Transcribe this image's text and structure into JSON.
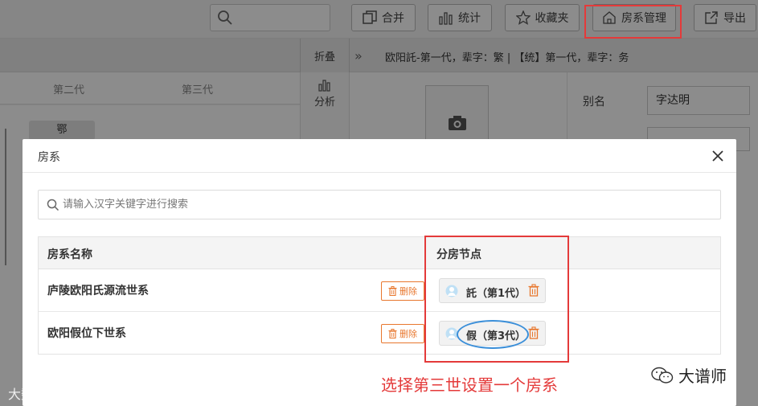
{
  "toolbar": {
    "merge_label": "合并",
    "stats_label": "统计",
    "favorites_label": "收藏夹",
    "branch_mgmt_label": "房系管理",
    "export_label": "导出"
  },
  "subbar": {
    "fold_label": "折叠",
    "info": "欧阳託-第一代，辈字：繁   |   【统】第一代，辈字：务"
  },
  "tree": {
    "gen2": "第二代",
    "gen3": "第三代",
    "node_label": "鄂"
  },
  "side": {
    "analysis_label": "分析"
  },
  "form": {
    "alias_label": "别名",
    "alias_value": "字达明"
  },
  "modal": {
    "title": "房系",
    "search_placeholder": "请输入汉字关键字进行搜索",
    "col_name": "房系名称",
    "col_node": "分房节点",
    "delete_label": "删除",
    "rows": [
      {
        "name": "庐陵欧阳氏源流世系",
        "node": "託（第1代）"
      },
      {
        "name": "欧阳假位下世系",
        "node": "假（第3代）"
      }
    ]
  },
  "annotation": "选择第三世设置一个房系",
  "watermark_left": "大数跨境",
  "watermark_right": "大谱师",
  "colors": {
    "highlight_red": "#e43a3a",
    "delete_orange": "#e8772e",
    "oval_blue": "#3b8fd9"
  }
}
